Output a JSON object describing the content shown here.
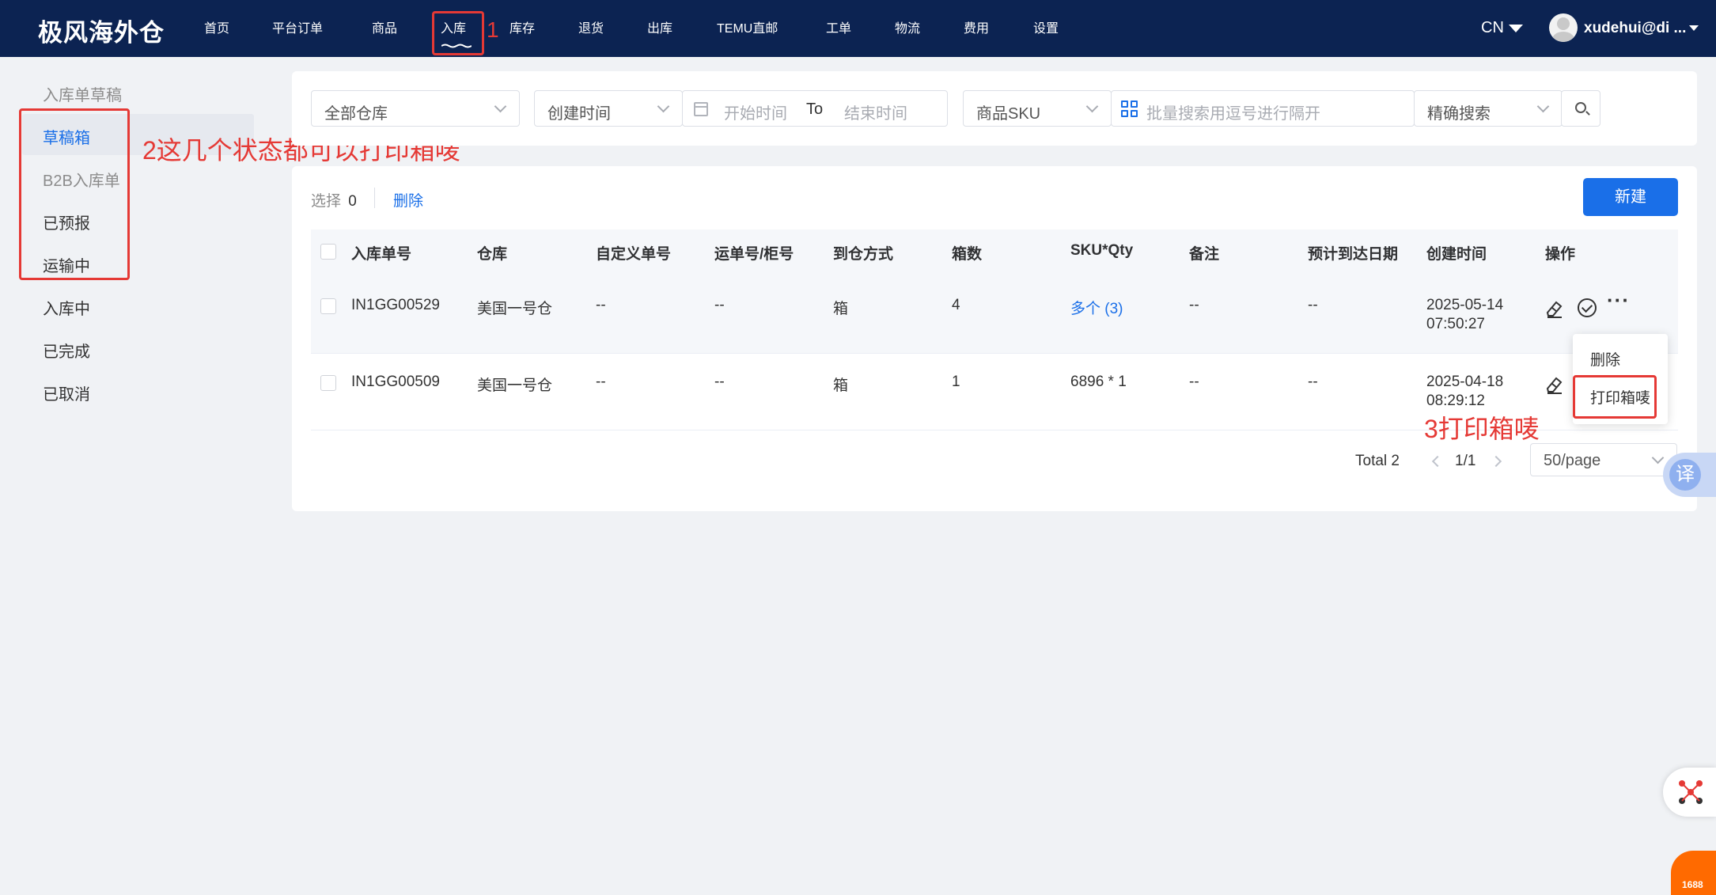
{
  "app": {
    "logo": "极风海外仓"
  },
  "nav": {
    "items": [
      "首页",
      "平台订单",
      "商品",
      "入库",
      "库存",
      "退货",
      "出库",
      "TEMU直邮",
      "工单",
      "物流",
      "费用",
      "设置"
    ],
    "active_index": 3
  },
  "header": {
    "language": "CN",
    "user": "xudehui@di ..."
  },
  "sidebar": {
    "items": [
      "入库单草稿",
      "草稿箱",
      "B2B入库单",
      "已预报",
      "运输中",
      "入库中",
      "已完成",
      "已取消"
    ],
    "active_index": 1
  },
  "annotations": {
    "a1": "1",
    "a2": "2这几个状态都可以打印箱唛",
    "a3": "3打印箱唛",
    "color": "#e53935"
  },
  "filters": {
    "warehouse": "全部仓库",
    "time_type": "创建时间",
    "start_placeholder": "开始时间",
    "to": "To",
    "end_placeholder": "结束时间",
    "search_field": "商品SKU",
    "search_placeholder": "批量搜索用逗号进行隔开",
    "search_mode": "精确搜索"
  },
  "toolbar": {
    "selected_label": "选择",
    "selected_count": "0",
    "delete_label": "删除",
    "new_label": "新建"
  },
  "table": {
    "columns": [
      "入库单号",
      "仓库",
      "自定义单号",
      "运单号/柜号",
      "到仓方式",
      "箱数",
      "SKU*Qty",
      "备注",
      "预计到达日期",
      "创建时间",
      "操作"
    ],
    "rows": [
      {
        "order_no": "IN1GG00529",
        "warehouse": "美国一号仓",
        "custom_no": "--",
        "tracking": "--",
        "method": "箱",
        "boxes": "4",
        "sku_qty": "多个 (3)",
        "remark": "--",
        "eta": "--",
        "created_date": "2025-05-14",
        "created_time": "07:50:27"
      },
      {
        "order_no": "IN1GG00509",
        "warehouse": "美国一号仓",
        "custom_no": "--",
        "tracking": "--",
        "method": "箱",
        "boxes": "1",
        "sku_qty": "6896 * 1",
        "remark": "--",
        "eta": "--",
        "created_date": "2025-04-18",
        "created_time": "08:29:12"
      }
    ]
  },
  "dropdown": {
    "items": [
      "删除",
      "打印箱唛"
    ]
  },
  "pagination": {
    "total": "Total 2",
    "page": "1/1",
    "page_size": "50/page"
  },
  "floating": {
    "translate": "译",
    "badge": "1688"
  },
  "colors": {
    "header_bg": "#0c2352",
    "primary": "#1a6fe8",
    "page_bg": "#f0f2f5"
  }
}
